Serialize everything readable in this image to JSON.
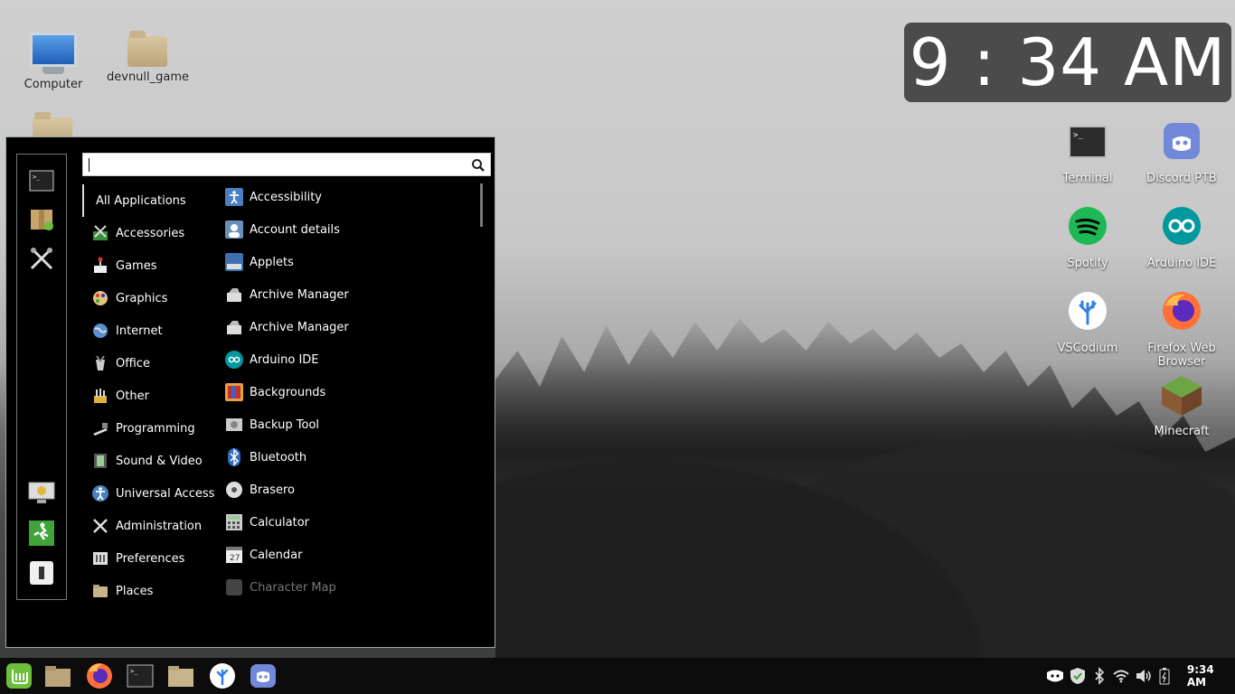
{
  "desktop": {
    "left_icons": [
      {
        "label": "Computer"
      },
      {
        "label": "devnull_game"
      }
    ],
    "right_icons": [
      {
        "label": "Terminal"
      },
      {
        "label": "Discord PTB"
      },
      {
        "label": "Spotify"
      },
      {
        "label": "Arduino IDE"
      },
      {
        "label": "VSCodium"
      },
      {
        "label": "Firefox Web Browser"
      },
      {
        "label": "Minecraft"
      }
    ]
  },
  "clock_widget": {
    "time": "9 : 34 AM"
  },
  "menu": {
    "search": {
      "value": "",
      "placeholder": ""
    },
    "favorites": [
      "terminal-icon",
      "software-manager-icon",
      "system-settings-icon"
    ],
    "session": [
      "lock-screen-icon",
      "logout-icon",
      "shutdown-icon"
    ],
    "categories": [
      {
        "label": "All Applications"
      },
      {
        "label": "Accessories"
      },
      {
        "label": "Games"
      },
      {
        "label": "Graphics"
      },
      {
        "label": "Internet"
      },
      {
        "label": "Office"
      },
      {
        "label": "Other"
      },
      {
        "label": "Programming"
      },
      {
        "label": "Sound & Video"
      },
      {
        "label": "Universal Access"
      },
      {
        "label": "Administration"
      },
      {
        "label": "Preferences"
      },
      {
        "label": "Places"
      }
    ],
    "applications": [
      {
        "label": "Accessibility"
      },
      {
        "label": "Account details"
      },
      {
        "label": "Applets"
      },
      {
        "label": "Archive Manager"
      },
      {
        "label": "Archive Manager"
      },
      {
        "label": "Arduino IDE"
      },
      {
        "label": "Backgrounds"
      },
      {
        "label": "Backup Tool"
      },
      {
        "label": "Bluetooth"
      },
      {
        "label": "Brasero"
      },
      {
        "label": "Calculator"
      },
      {
        "label": "Calendar"
      },
      {
        "label": "Character Map"
      }
    ]
  },
  "panel": {
    "launchers": [
      "mint-menu-icon",
      "file-manager-icon",
      "firefox-icon",
      "terminal-icon",
      "folder-icon",
      "vscodium-icon",
      "discord-icon"
    ],
    "tray_time": "9:34 AM"
  },
  "colors": {
    "accent_green": "#6bbf3a",
    "panel_bg": "#0c0c0c",
    "menu_bg": "#000000"
  }
}
